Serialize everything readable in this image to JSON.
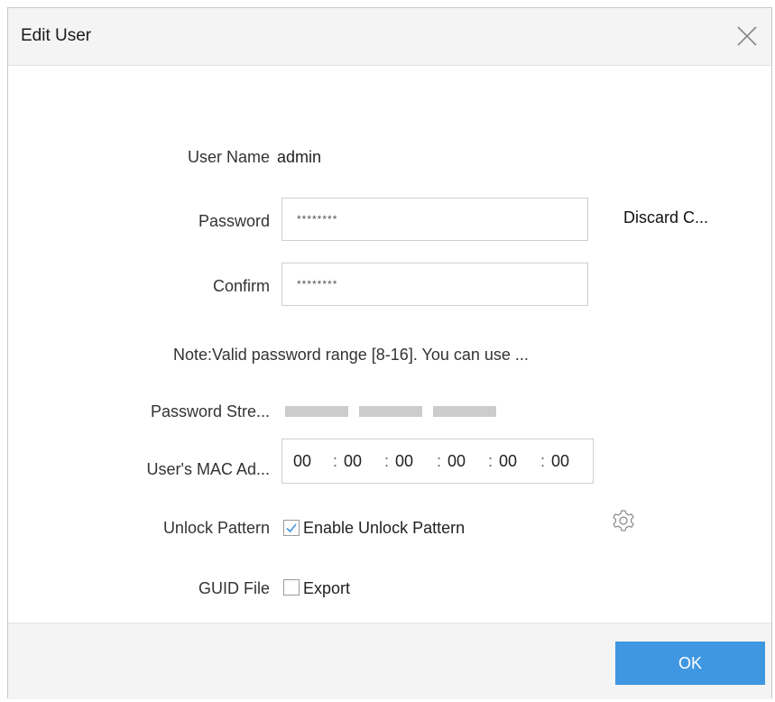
{
  "dialog": {
    "title": "Edit User",
    "close_icon": "close-icon"
  },
  "form": {
    "username": {
      "label": "User Name",
      "value": "admin"
    },
    "password": {
      "label": "Password",
      "value": "********"
    },
    "discard_label": "Discard C...",
    "confirm": {
      "label": "Confirm",
      "value": "********"
    },
    "note": "Note:Valid password range [8-16]. You can use ...",
    "strength": {
      "label": "Password Stre...",
      "bar_color": "#cccccc"
    },
    "mac": {
      "label": "User's MAC Ad...",
      "segments": [
        "00",
        "00",
        "00",
        "00",
        "00",
        "00"
      ],
      "separator": ":"
    },
    "unlock": {
      "label": "Unlock Pattern",
      "checkbox_label": "Enable Unlock Pattern",
      "checked": true,
      "settings_icon": "gear-icon"
    },
    "guid": {
      "label": "GUID File",
      "checkbox_label": "Export",
      "checked": false
    }
  },
  "footer": {
    "ok_label": "OK",
    "ok_color": "#3f97e2"
  }
}
